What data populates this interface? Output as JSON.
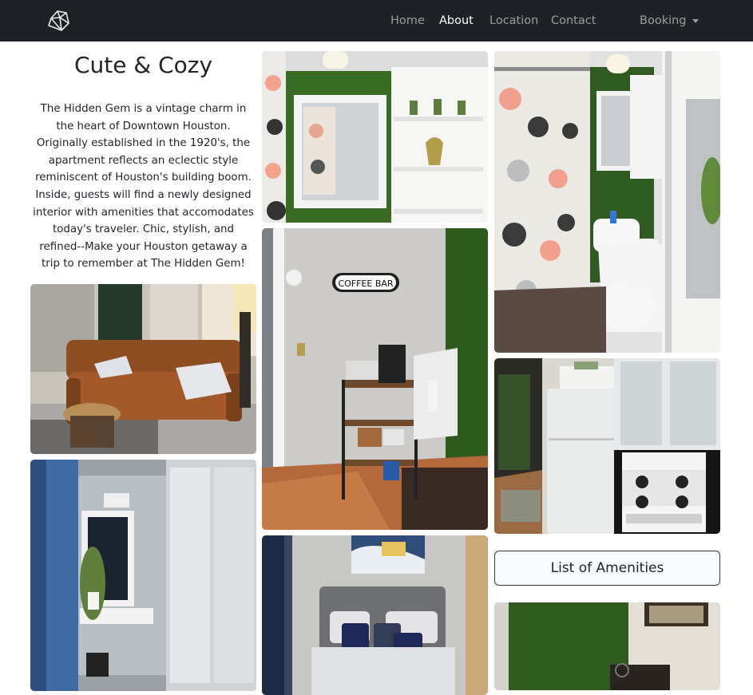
{
  "navbar": {
    "brand_icon": "diamond-logo-icon",
    "links": [
      "Home",
      "About",
      "Location",
      "Contact"
    ],
    "active": "About",
    "booking_label": "Booking"
  },
  "intro": {
    "title": "Cute & Cozy",
    "description": "The Hidden Gem is a vintage charm in the heart of Downtown Houston. Originally established in the 1920's, the apartment reflects an eclectic style reminiscent of Houston's building boom. Inside, guests will find a newly designed interior with amenities that accomodates today's traveler. Chic, stylish, and refined--Make your Houston getaway a trip to remember at The Hidden Gem!"
  },
  "gallery": {
    "coffee_sign": "COFFEE BAR",
    "photos": [
      "living-room",
      "vanity-closet",
      "bathroom-shelves",
      "coffee-bar",
      "bedroom",
      "bathroom",
      "kitchen",
      "dining-area"
    ]
  },
  "amenities_button": "List of Amenities",
  "colors": {
    "navbar_bg": "#1e2126",
    "nav_link": "#9a9ea3",
    "nav_active": "#ffffff",
    "button_border": "#343a40"
  }
}
